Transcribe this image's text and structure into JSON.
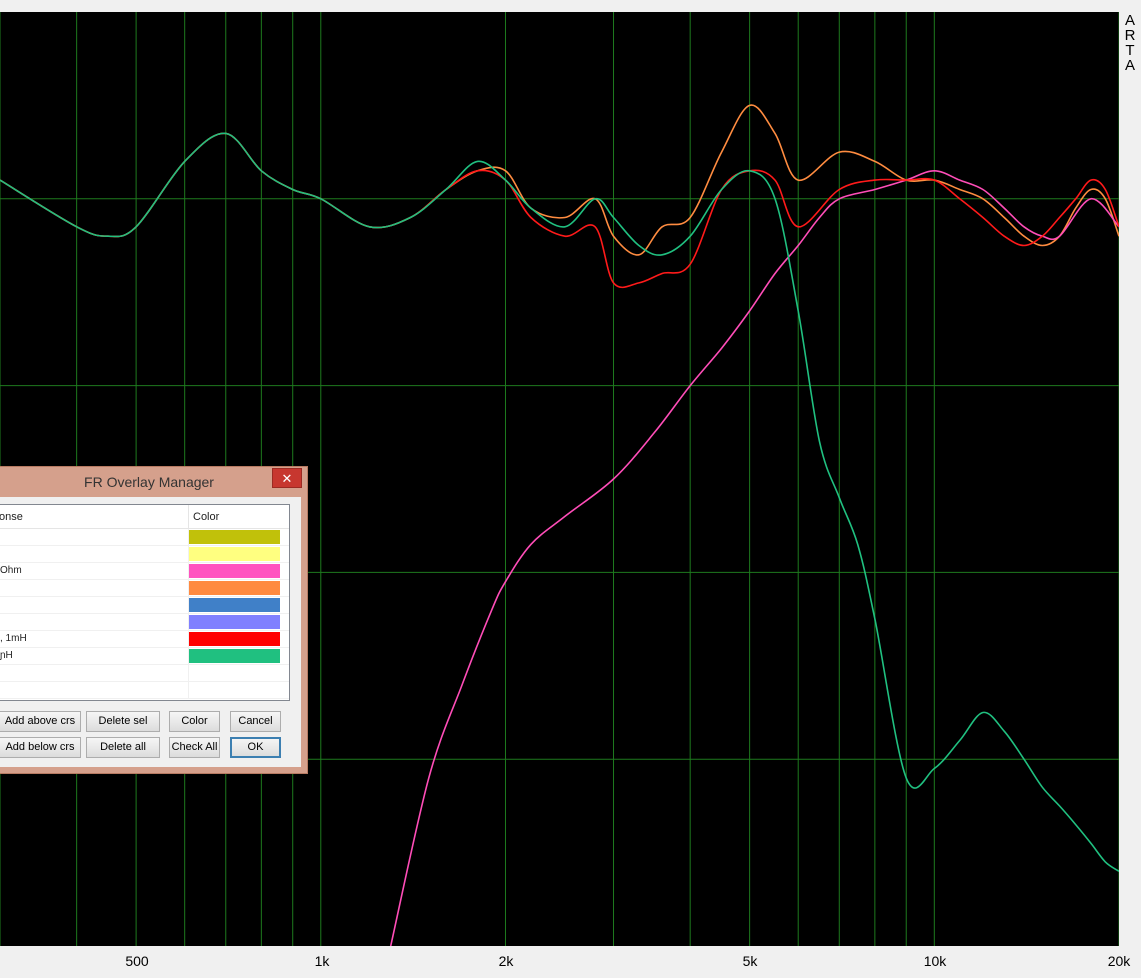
{
  "window": {
    "logo_letters": [
      "A",
      "R",
      "T",
      "A"
    ]
  },
  "plot": {
    "colors": {
      "background": "#000000",
      "grid": "#1e7a1e"
    },
    "x_tick_labels": [
      "500",
      "1k",
      "2k",
      "5k",
      "10k",
      "20k"
    ]
  },
  "chart_data": {
    "type": "line",
    "xscale": "log",
    "xlim": [
      300,
      20000
    ],
    "xticks": [
      "500",
      "1k",
      "2k",
      "5k",
      "10k",
      "20k"
    ],
    "ylim": [
      0,
      100
    ],
    "series": [
      {
        "color": "#ff8c40",
        "x": [
          300,
          400,
          450,
          500,
          600,
          700,
          800,
          900,
          1000,
          1200,
          1400,
          1600,
          1800,
          2000,
          2200,
          2500,
          2800,
          3000,
          3300,
          3600,
          4000,
          4500,
          5000,
          5500,
          6000,
          7000,
          8000,
          9000,
          10000,
          11000,
          12000,
          13000,
          14000,
          15000,
          16000,
          17000,
          18000,
          19000,
          20000
        ],
        "y": [
          82,
          77,
          76,
          77,
          84,
          87,
          83,
          81,
          80,
          77,
          78,
          81,
          83,
          83,
          79,
          78,
          80,
          76,
          74,
          77,
          78,
          85,
          90,
          87,
          82,
          85,
          84,
          82,
          82,
          81,
          80,
          78,
          76,
          75,
          76,
          79,
          81,
          80,
          76
        ]
      },
      {
        "color": "#ff4db8",
        "x": [
          1300,
          1500,
          1700,
          1900,
          2000,
          2200,
          2500,
          3000,
          3500,
          4000,
          4500,
          5000,
          5500,
          6000,
          6500,
          7000,
          8000,
          9000,
          10000,
          11000,
          12000,
          13000,
          14000,
          15000,
          16000,
          18000,
          20000
        ],
        "y": [
          0,
          18,
          28,
          36,
          39,
          43,
          46,
          50,
          55,
          60,
          64,
          68,
          72,
          75,
          78,
          80,
          81,
          82,
          83,
          82,
          81,
          79,
          77,
          76,
          76,
          80,
          77
        ]
      },
      {
        "color": "#ff1a1a",
        "x": [
          300,
          400,
          450,
          500,
          600,
          700,
          800,
          900,
          1000,
          1200,
          1400,
          1600,
          1800,
          2000,
          2200,
          2500,
          2800,
          3000,
          3300,
          3600,
          4000,
          4500,
          5000,
          5500,
          6000,
          7000,
          8000,
          9000,
          10000,
          11000,
          12000,
          13000,
          14000,
          15000,
          16000,
          17000,
          18000,
          19000,
          20000
        ],
        "y": [
          82,
          77,
          76,
          77,
          84,
          87,
          83,
          81,
          80,
          77,
          78,
          81,
          83,
          82,
          78,
          76,
          77,
          71,
          71,
          72,
          73,
          81,
          83,
          82,
          77,
          81,
          82,
          82,
          82,
          80,
          78,
          76,
          75,
          76,
          78,
          80,
          82,
          81,
          77
        ]
      },
      {
        "color": "#20c080",
        "x": [
          300,
          400,
          450,
          500,
          600,
          700,
          800,
          900,
          1000,
          1200,
          1400,
          1600,
          1800,
          2000,
          2200,
          2500,
          2800,
          3000,
          3300,
          3600,
          4000,
          4500,
          5000,
          5500,
          6000,
          6500,
          7000,
          7500,
          8000,
          9000,
          10000,
          11000,
          12000,
          13000,
          14000,
          15000,
          16000,
          17000,
          18000,
          19000,
          20000
        ],
        "y": [
          82,
          77,
          76,
          77,
          84,
          87,
          83,
          81,
          80,
          77,
          78,
          81,
          84,
          82,
          79,
          77,
          80,
          78,
          75,
          74,
          76,
          81,
          83,
          80,
          68,
          54,
          48,
          43,
          35,
          18,
          19,
          22,
          25,
          23,
          20,
          17,
          15,
          13,
          11,
          9,
          8
        ]
      }
    ]
  },
  "dialog": {
    "title": "FR Overlay Manager",
    "columns": [
      "onse",
      "Color"
    ],
    "rows": [
      {
        "name": "",
        "color": "#c1c10a"
      },
      {
        "name": "",
        "color": "#ffff80"
      },
      {
        "name": " Ohm",
        "color": "#ff52c0"
      },
      {
        "name": "",
        "color": "#ff8a40"
      },
      {
        "name": "",
        "color": "#4080c8"
      },
      {
        "name": "",
        "color": "#8080ff"
      },
      {
        "name": ", 1mH",
        "color": "#ff0000"
      },
      {
        "name": "ɲH",
        "color": "#20c080"
      },
      {
        "name": "",
        "color": ""
      },
      {
        "name": "",
        "color": ""
      }
    ],
    "buttons": {
      "add_above": "Add above crs",
      "delete_sel": "Delete sel",
      "color": "Color",
      "cancel": "Cancel",
      "add_below": "Add below crs",
      "delete_all": "Delete all",
      "check_all": "Check All",
      "ok": "OK"
    },
    "close_glyph": "✕"
  }
}
